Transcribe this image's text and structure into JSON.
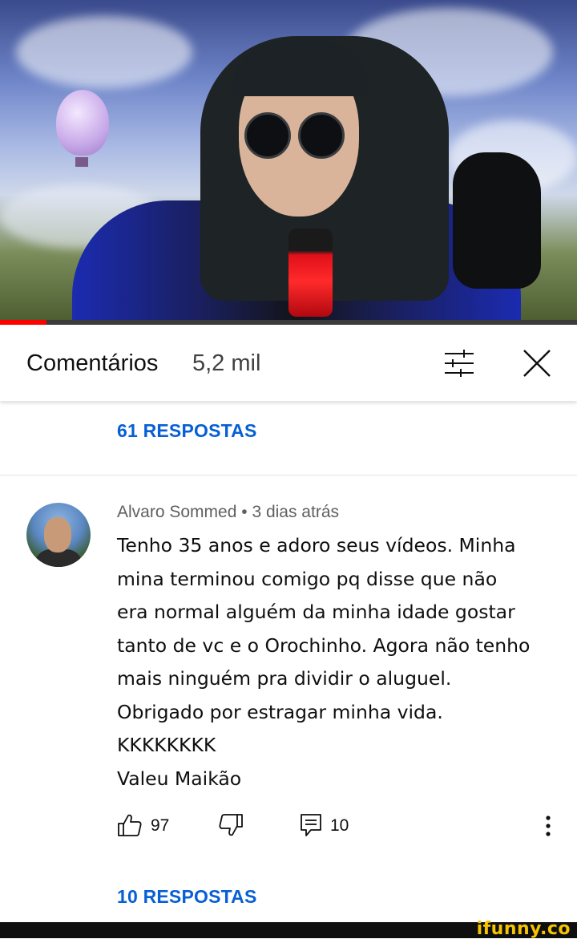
{
  "header": {
    "title": "Comentários",
    "count": "5,2 mil"
  },
  "top_replies_label": "61 RESPOSTAS",
  "comment": {
    "author": "Alvaro Sommed",
    "separator": "•",
    "time": "3 dias atrás",
    "lines": [
      "Tenho 35 anos e adoro seus vídeos. Minha",
      "mina terminou comigo pq disse que não",
      "era normal alguém da minha idade gostar",
      "tanto de vc e o Orochinho. Agora não tenho",
      "mais ninguém pra dividir o aluguel.",
      "Obrigado por estragar minha vida.",
      "KKKKKKKK",
      "Valeu Maikão"
    ],
    "likes": "97",
    "replies_count": "10",
    "replies_label": "10 RESPOSTAS"
  },
  "video": {
    "progress": 0.08
  },
  "watermark": "ifunny.co",
  "colors": {
    "link": "#065fd4",
    "progress": "#ff0000",
    "watermark": "#f6c400"
  },
  "icons": [
    "filter-icon",
    "close-icon",
    "thumbs-up-icon",
    "thumbs-down-icon",
    "reply-icon",
    "more-vert-icon"
  ]
}
